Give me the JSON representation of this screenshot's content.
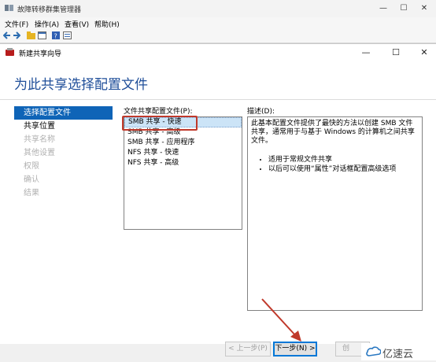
{
  "window": {
    "title": "故障转移群集管理器",
    "controls": [
      "—",
      "☐",
      "✕"
    ]
  },
  "menu": {
    "items": [
      "文件(F)",
      "操作(A)",
      "查看(V)",
      "帮助(H)"
    ]
  },
  "dialog": {
    "title": "新建共享向导",
    "controls": [
      "—",
      "☐",
      "✕"
    ],
    "heading": "为此共享选择配置文件",
    "nav": [
      {
        "label": "选择配置文件",
        "state": "selected"
      },
      {
        "label": "共享位置",
        "state": "enabled"
      },
      {
        "label": "共享名称",
        "state": "disabled"
      },
      {
        "label": "其他设置",
        "state": "disabled"
      },
      {
        "label": "权限",
        "state": "disabled"
      },
      {
        "label": "确认",
        "state": "disabled"
      },
      {
        "label": "结果",
        "state": "disabled"
      }
    ],
    "profiles_label": "文件共享配置文件(P):",
    "profiles": [
      "SMB 共享 - 快速",
      "SMB 共享 - 高级",
      "SMB 共享 - 应用程序",
      "NFS 共享 - 快速",
      "NFS 共享 - 高级"
    ],
    "selected_profile_index": 0,
    "description_label": "描述(D):",
    "description_text": "此基本配置文件提供了最快的方法以创建 SMB 文件共享，通常用于与基于 Windows 的计算机之间共享文件。",
    "description_bullets": [
      "适用于常规文件共享",
      "以后可以使用“属性”对话框配置高级选项"
    ],
    "buttons": {
      "prev": "< 上一步(P)",
      "next": "下一步(N) >",
      "create_partial": "创"
    }
  },
  "watermark": {
    "text": "亿速云"
  }
}
